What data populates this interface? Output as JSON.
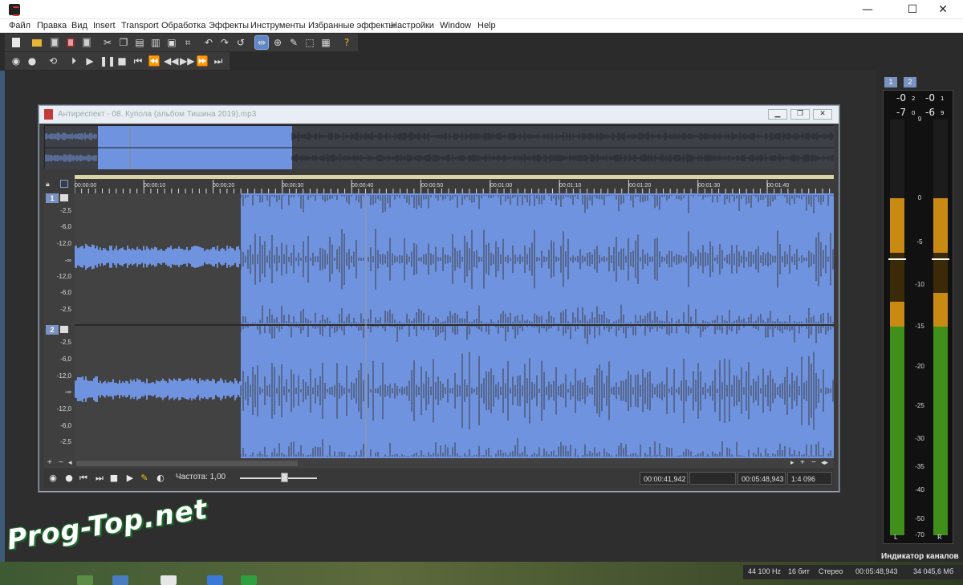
{
  "menu": [
    "Файл",
    "Правка",
    "Вид",
    "Insert",
    "Transport",
    "Обработка",
    "Эффекты",
    "Инструменты",
    "Избранные эффекты",
    "Настройки",
    "Window",
    "Help"
  ],
  "window_controls": {
    "minimize": "—",
    "maximize": "☐",
    "close": "✕"
  },
  "document": {
    "title": "Антиреспект - 08. Купола (альбом Тишина 2019).mp3",
    "ruler_labels": [
      "00:00:00",
      "00:00:10",
      "00:00:20",
      "00:00:30",
      "00:00:40",
      "00:00:50",
      "00:01:00",
      "00:01:10",
      "00:01:20",
      "00:01:30",
      "00:01:40"
    ],
    "channels": [
      {
        "badge": "1",
        "scale": [
          "-2,5",
          "-6,0",
          "-12,0",
          "-∞",
          "-12,0",
          "-6,0",
          "-2,5"
        ]
      },
      {
        "badge": "2",
        "scale": [
          "-2,5",
          "-6,0",
          "-12,0",
          "-∞",
          "-12,0",
          "-6,0",
          "-2,5"
        ]
      }
    ],
    "scroll_left": [
      "+",
      "−",
      "◂"
    ],
    "scroll_right": [
      "▸",
      "+",
      "−",
      "◂▸"
    ],
    "rate_label": "Частота: 1,00",
    "cursor_time": "00:00:41,942",
    "selection_length": "",
    "total_time": "00:05:48,943",
    "zoom": "1:4 096"
  },
  "meters": {
    "tabs": [
      "1",
      "2"
    ],
    "peak_l": "-0",
    "peak_l_sub": "2",
    "peak_r": "-0",
    "peak_r_sub": "1",
    "rms_l": "-7",
    "rms_l_sub": "0",
    "rms_r": "-6",
    "rms_r_sub": "9",
    "scale": [
      "9",
      "0",
      "-5",
      "-10",
      "-15",
      "-20",
      "-25",
      "-30",
      "-35",
      "-40",
      "-50",
      "-70"
    ],
    "left_label": "L",
    "right_label": "R",
    "level_l_db": -12,
    "level_r_db": -11,
    "panel_label": "Индикатор каналов"
  },
  "status": {
    "sample_rate": "44 100 Hz",
    "bit_depth": "16 бит",
    "channels": "Стерео",
    "duration": "00:05:48,943",
    "size": "34 045,6 Мб"
  },
  "watermark": "Prog-Top.net",
  "colors": {
    "wave_selection": "#7093e0",
    "wave_dark": "#3a3c44",
    "wave_unselected_bg": "#424242",
    "meter_orange": "#c88a12",
    "meter_green": "#3f8f1a"
  }
}
